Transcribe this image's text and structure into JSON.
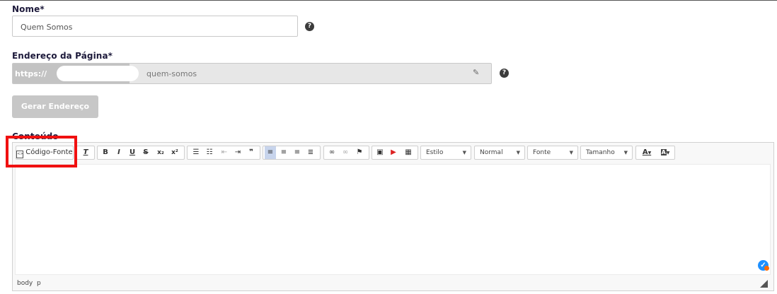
{
  "fields": {
    "name_label": "Nome*",
    "name_value": "Quem Somos",
    "address_label": "Endereço da Página*",
    "address_prefix": "https://",
    "address_slug": "quem-somos",
    "generate_button": "Gerar Endereço",
    "content_label": "Conteúdo"
  },
  "icons": {
    "help": "question-circle-icon",
    "edit": "pencil-icon"
  },
  "editor": {
    "source_button": "Código-Fonte",
    "format": {
      "bold": "B",
      "italic": "I",
      "underline": "U",
      "strike": "S",
      "subscript": "x₂",
      "superscript": "x²"
    },
    "combos": {
      "style": "Estilo",
      "format": "Normal",
      "font": "Fonte",
      "size": "Tamanho"
    },
    "text_color": "A",
    "bg_color": "A",
    "status_path": "body  p"
  },
  "colors": {
    "highlight": "#f01010",
    "heading": "#1d1a3b"
  }
}
